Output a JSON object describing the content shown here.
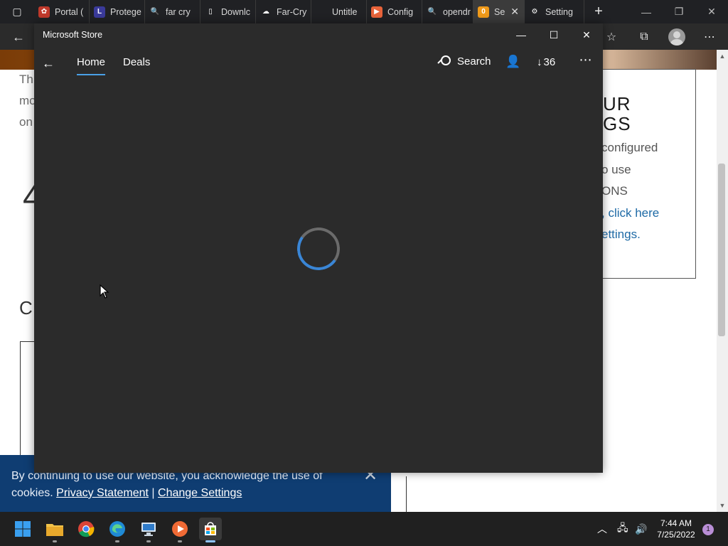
{
  "browser": {
    "tabs": [
      {
        "label": "Portal (",
        "fav_color": "#c0392b",
        "fav": "✿",
        "active": false
      },
      {
        "label": "Protege",
        "fav_color": "#3a3a9a",
        "fav": "L",
        "active": false
      },
      {
        "label": "far cry",
        "fav_color": "transparent",
        "fav": "🔍",
        "active": false
      },
      {
        "label": "Downlc",
        "fav_color": "transparent",
        "fav": "▯",
        "active": false
      },
      {
        "label": "Far-Cry",
        "fav_color": "transparent",
        "fav": "☁",
        "active": false
      },
      {
        "label": "Untitle",
        "fav_color": "transparent",
        "fav": "",
        "active": false
      },
      {
        "label": "Config",
        "fav_color": "#e8633a",
        "fav": "▶",
        "active": false
      },
      {
        "label": "opendr",
        "fav_color": "transparent",
        "fav": "🔍",
        "active": false
      },
      {
        "label": "Se",
        "fav_color": "#f09a1a",
        "fav": "0",
        "active": true
      },
      {
        "label": "Setting",
        "fav_color": "transparent",
        "fav": "⚙",
        "active": false
      }
    ],
    "new_tab_glyph": "+"
  },
  "page": {
    "left_lines": [
      "Th",
      "mo",
      "on"
    ],
    "big_glyph": "4",
    "section_letter": "C",
    "right_card": {
      "heading_lines": [
        "UR",
        "GS"
      ],
      "lines": [
        "configured",
        "o use",
        "ONS"
      ],
      "link_lines": [
        ", click here",
        "ettings."
      ]
    }
  },
  "cookie": {
    "text": "By continuing to use our website, you acknowledge the use of cookies.",
    "privacy_link": "Privacy Statement",
    "separator": " | ",
    "settings_link": "Change Settings",
    "close_glyph": "✕"
  },
  "store": {
    "title": "Microsoft Store",
    "nav_home": "Home",
    "nav_deals": "Deals",
    "search_label": "Search",
    "downloads_count": "36",
    "accent": "#3a86d6"
  },
  "taskbar": {
    "apps": [
      "start",
      "file-explorer",
      "chrome",
      "edge",
      "remote-desktop",
      "media-player",
      "microsoft-store"
    ],
    "time": "7:44 AM",
    "date": "7/25/2022",
    "notification_count": "1"
  }
}
